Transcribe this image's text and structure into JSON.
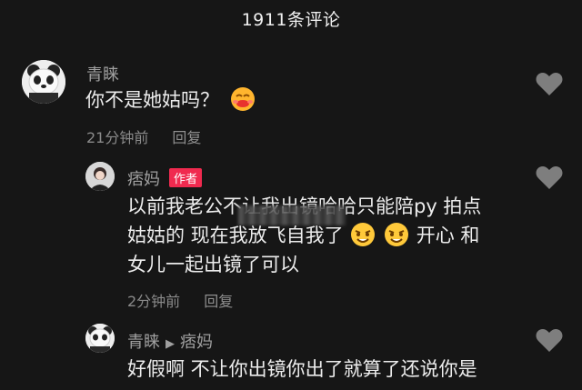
{
  "header": {
    "title": "1911条评论"
  },
  "comments": [
    {
      "username": "青睐",
      "text": "你不是她姑吗？",
      "time": "21分钟前",
      "reply_label": "回复"
    },
    {
      "username": "痞妈",
      "badge": "作者",
      "lines": [
        "以前我老公不让我出镜哈哈只能陪py 拍点",
        "姑姑的 现在我放飞自我了",
        "开心 和",
        "女儿一起出镜了可以"
      ],
      "time": "2分钟前",
      "reply_label": "回复"
    },
    {
      "username": "青睐",
      "reply_to": "痞妈",
      "text": "好假啊 不让你出镜你出了就算了还说你是"
    }
  ],
  "colors": {
    "background": "#161616",
    "author_badge": "#f02a4f",
    "heart": "#7e7e7e"
  },
  "icons": [
    "heart-icon",
    "panda-avatar-icon",
    "blushing-emoji-icon",
    "laughing-emoji-icon",
    "play-arrow-icon"
  ]
}
